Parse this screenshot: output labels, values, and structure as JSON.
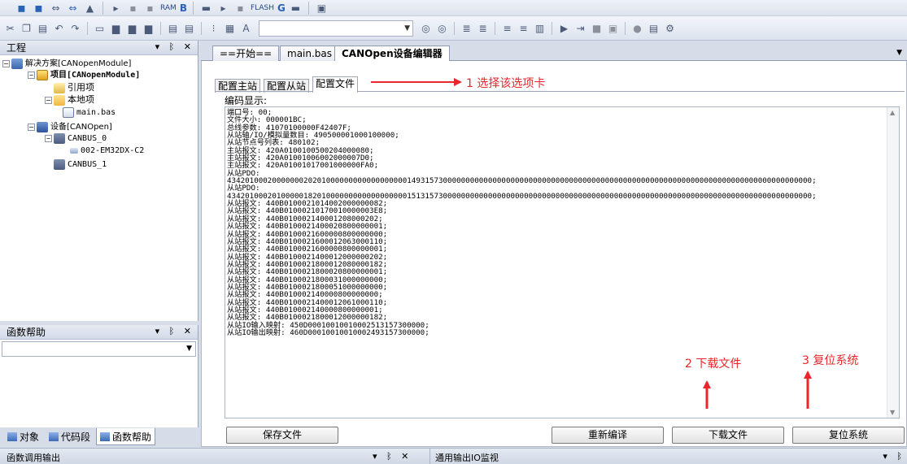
{
  "toolbar_top": {
    "labels": [
      "RAM",
      "B",
      "FLASH",
      "G"
    ]
  },
  "toolbar": {
    "combo_value": ""
  },
  "project_panel": {
    "title": "工程",
    "controls": "▾ ᛒ ✕",
    "tree": {
      "solution": "解决方案[CANopenModule]",
      "project": "项目[CANopenModule]",
      "references": "引用项",
      "local_items": "本地项",
      "main_file": "main.bas",
      "devices": "设备[CANOpen]",
      "canbus0": "CANBUS_0",
      "node": "002-EM32DX-C2",
      "canbus1": "CANBUS_1"
    }
  },
  "function_panel": {
    "title": "函数帮助",
    "combo_value": ""
  },
  "left_tabs": [
    "对象",
    "代码段",
    "函数帮助"
  ],
  "doc_tabs": [
    "==开始==",
    "main.bas",
    "CANOpen设备编辑器"
  ],
  "config_tabs": [
    "配置主站",
    "配置从站",
    "配置文件"
  ],
  "encoding_label": "编码显示:",
  "code_lines": [
    "端口号: 00;",
    "文件大小: 000001BC;",
    "总线参数: 41070100000F42407F;",
    "从站轴/IO/模拟量数目: 490500001000100000;",
    "从站节点号列表: 480102;",
    "主站报文: 420A0100100500204000080;",
    "主站报文: 420A01001006002000007D0;",
    "主站报文: 420A01001017001000000FA0;",
    "从站PDO:",
    "4342010002000000020201000000000000000000149315730000000000000000000000000000000000000000000000000000000000000000000000000000000000;",
    "从站PDO:",
    "4342010002010000018201000000000000000000151315730000000000000000000000000000000000000000000000000000000000000000000000000000000000;",
    "从站报文: 440B0100021014002000000082;",
    "从站报文: 440B01000210170010000003E8;",
    "从站报文: 440B010002140001208000202;",
    "从站报文: 440B0100021400020800000001;",
    "从站报文: 440B0100021600000800000000;",
    "从站报文: 440B0100021600012063000110;",
    "从站报文: 440B0100021600000800000001;",
    "从站报文: 440B0100021400012000000202;",
    "从站报文: 440B0100021800012080000182;",
    "从站报文: 440B0100021800020800000001;",
    "从站报文: 440B0100021800031000000000;",
    "从站报文: 440B0100021800051000000000;",
    "从站报文: 440B010002140000800000000;",
    "从站报文: 440B0100021400012061000110;",
    "从站报文: 440B010002140000800000001;",
    "从站报文: 440B0100021800012000000182;",
    "从站IO输入映射: 450D00010010010002513157300000;",
    "从站IO输出映射: 460D00010010010002493157300000;"
  ],
  "buttons": {
    "save": "保存文件",
    "recompile": "重新编译",
    "download": "下载文件",
    "reset": "复位系统"
  },
  "annotations": {
    "step1": "1 选择该选项卡",
    "step2": "2 下载文件",
    "step3": "3 复位系统",
    "color": "#e8262b"
  },
  "status_bar": {
    "left_title": "函数调用输出",
    "right_title": "通用输出IO监视",
    "controls": "▾ ᛒ ✕"
  }
}
